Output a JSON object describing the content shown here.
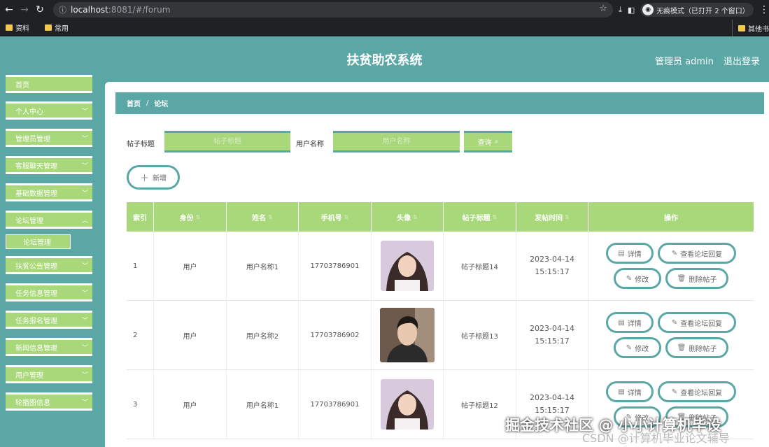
{
  "browser": {
    "url_host": "localhost",
    "url_rest": ":8081/#/forum",
    "incognito_label": "无痕模式（已打开 2 个窗口）",
    "bookmarks": [
      "资料",
      "常用"
    ],
    "bookmark_other": "其他书"
  },
  "header": {
    "title": "扶贫助农系统",
    "admin": "管理员 admin",
    "logout": "退出登录"
  },
  "sidebar": {
    "top_partial": "首页",
    "items": [
      "个人中心",
      "管理员管理",
      "客服聊天管理",
      "基础数据管理",
      "论坛管理",
      "扶贫公告管理",
      "任务信息管理",
      "任务报名管理",
      "新闻信息管理",
      "用户管理",
      "轮播图信息"
    ],
    "sub_item": "论坛管理"
  },
  "breadcrumb": {
    "home": "首页",
    "sep": "/",
    "current": "论坛"
  },
  "search": {
    "title_label": "帖子标题",
    "title_placeholder": "帖子标题",
    "user_label": "用户名称",
    "user_placeholder": "用户名称",
    "query_button": "查询"
  },
  "add_button": "新增",
  "table": {
    "columns": [
      "索引",
      "身份",
      "姓名",
      "手机号",
      "头像",
      "帖子标题",
      "发帖时间",
      "操作"
    ],
    "rows": [
      {
        "index": "1",
        "role": "用户",
        "name": "用户名称1",
        "phone": "17703786901",
        "title": "帖子标题14",
        "time": "2023-04-14 15:15:17"
      },
      {
        "index": "2",
        "role": "用户",
        "name": "用户名称2",
        "phone": "17703786902",
        "title": "帖子标题13",
        "time": "2023-04-14 15:15:17"
      },
      {
        "index": "3",
        "role": "用户",
        "name": "用户名称1",
        "phone": "17703786901",
        "title": "帖子标题12",
        "time": "2023-04-14 15:15:17"
      }
    ],
    "actions": {
      "detail": "详情",
      "view_reply": "查看论坛回复",
      "edit": "修改",
      "delete": "删除帖子"
    }
  },
  "watermarks": {
    "line1": "掘金技术社区 @ 小小计算机毕设",
    "line2": "CSDN @计算机毕业论文辅导"
  }
}
